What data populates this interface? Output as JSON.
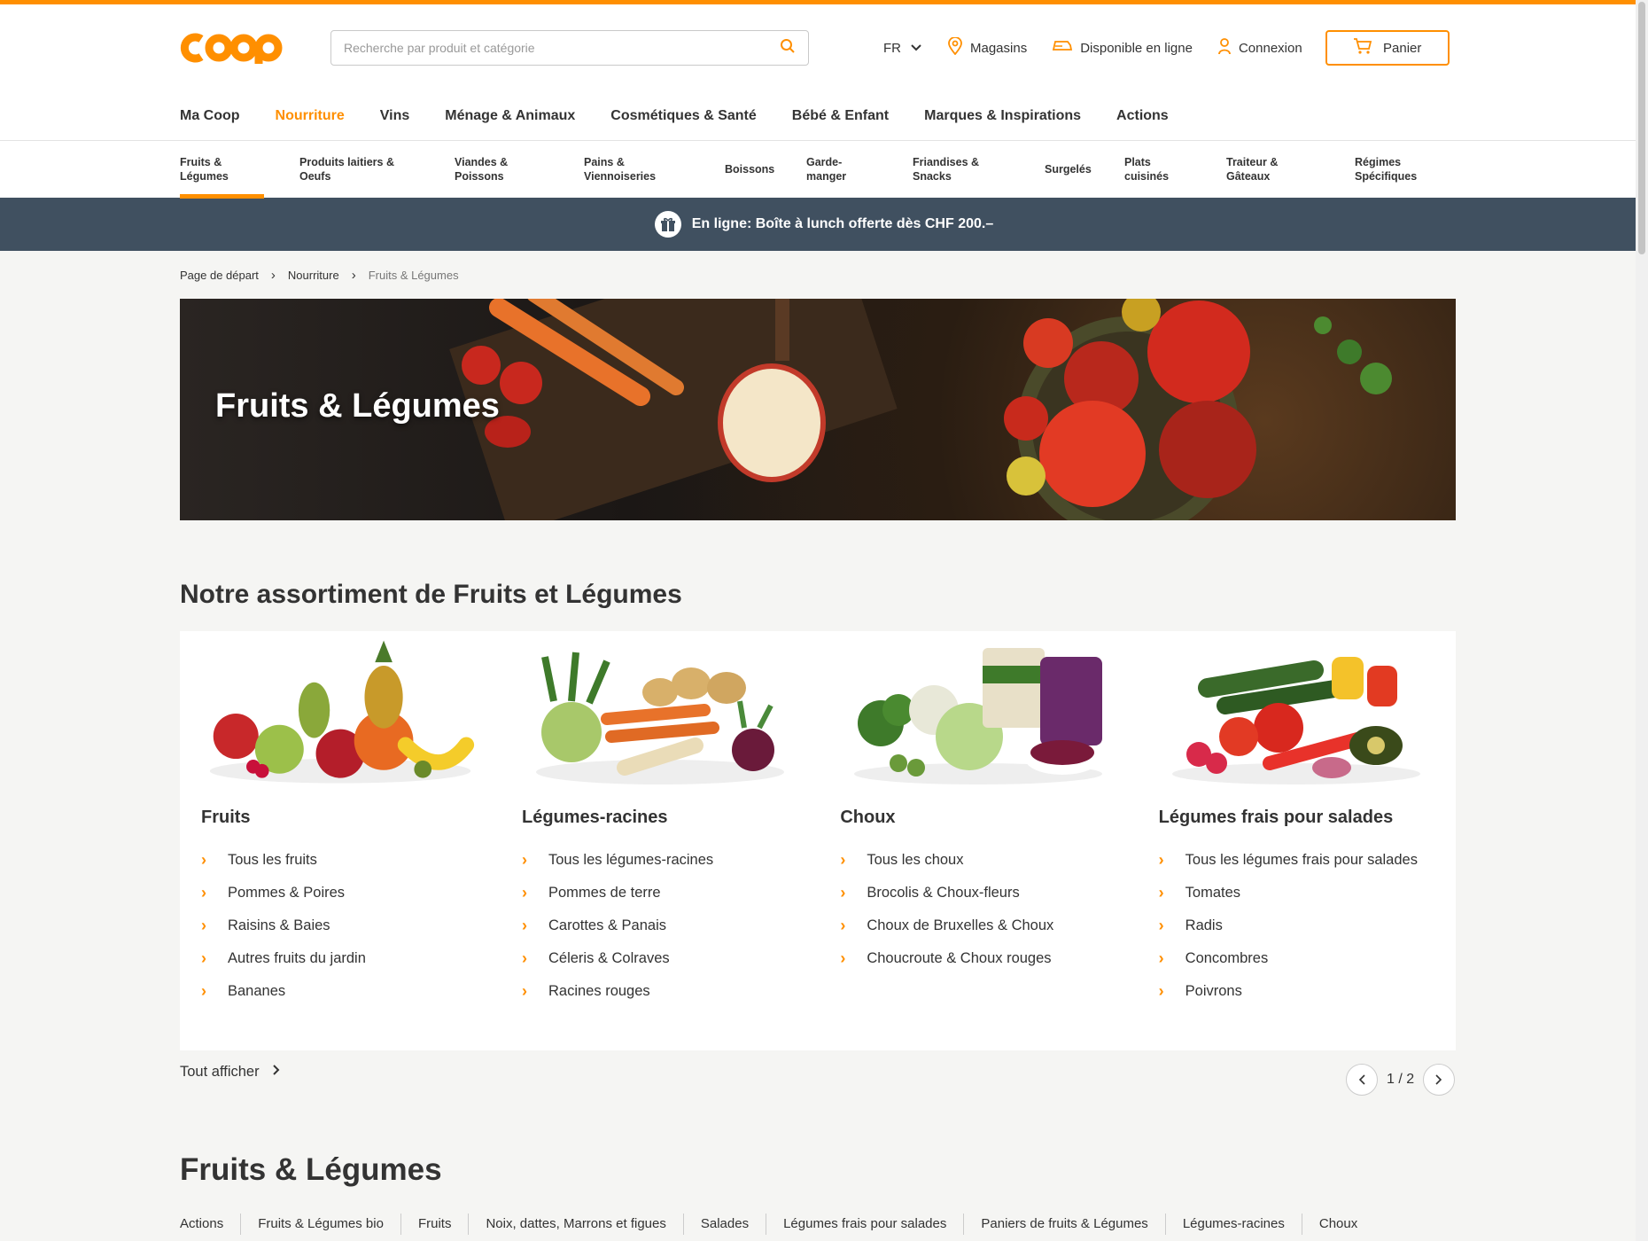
{
  "brand": {
    "logo_text": "coop",
    "accent": "#ff8f00",
    "promo_bg": "#405060"
  },
  "search": {
    "placeholder": "Recherche par produit et catégorie"
  },
  "header": {
    "lang": "FR",
    "stores": "Magasins",
    "online": "Disponible en ligne",
    "login": "Connexion",
    "cart": "Panier"
  },
  "main_nav": [
    {
      "label": "Ma Coop"
    },
    {
      "label": "Nourriture",
      "active": true
    },
    {
      "label": "Vins"
    },
    {
      "label": "Ménage & Animaux"
    },
    {
      "label": "Cosmétiques & Santé"
    },
    {
      "label": "Bébé & Enfant"
    },
    {
      "label": "Marques & Inspirations"
    },
    {
      "label": "Actions"
    }
  ],
  "sub_nav": [
    {
      "line1": "Fruits &",
      "line2": "Légumes",
      "active": true
    },
    {
      "line1": "Produits laitiers &",
      "line2": "Oeufs"
    },
    {
      "line1": "Viandes &",
      "line2": "Poissons"
    },
    {
      "line1": "Pains &",
      "line2": "Viennoiseries"
    },
    {
      "line1": "Boissons",
      "line2": ""
    },
    {
      "line1": "Garde-",
      "line2": "manger"
    },
    {
      "line1": "Friandises &",
      "line2": "Snacks"
    },
    {
      "line1": "Surgelés",
      "line2": ""
    },
    {
      "line1": "Plats",
      "line2": "cuisinés"
    },
    {
      "line1": "Traiteur &",
      "line2": "Gâteaux"
    },
    {
      "line1": "Régimes",
      "line2": "Spécifiques"
    }
  ],
  "promo": {
    "text": "En ligne: Boîte à lunch offerte dès CHF 200.–"
  },
  "breadcrumb": {
    "home": "Page de départ",
    "parent": "Nourriture",
    "current": "Fruits & Légumes"
  },
  "hero": {
    "title": "Fruits & Légumes"
  },
  "assortment": {
    "title": "Notre assortiment de Fruits et Légumes",
    "cards": [
      {
        "title": "Fruits",
        "links": [
          "Tous les fruits",
          "Pommes & Poires",
          "Raisins & Baies",
          "Autres fruits du jardin",
          "Bananes"
        ]
      },
      {
        "title": "Légumes-racines",
        "links": [
          "Tous les légumes-racines",
          "Pommes de terre",
          "Carottes & Panais",
          "Céleris & Colraves",
          "Racines rouges"
        ]
      },
      {
        "title": "Choux",
        "links": [
          "Tous les choux",
          "Brocolis & Choux-fleurs",
          "Choux de Bruxelles & Choux",
          "Choucroute & Choux rouges"
        ]
      },
      {
        "title": "Légumes frais pour salades",
        "links": [
          "Tous les légumes frais pour salades",
          "Tomates",
          "Radis",
          "Concombres",
          "Poivrons"
        ]
      }
    ],
    "show_all": "Tout afficher",
    "pager": "1 / 2"
  },
  "bottom_section": {
    "title": "Fruits & Légumes",
    "tabs": [
      "Actions",
      "Fruits & Légumes bio",
      "Fruits",
      "Noix, dattes, Marrons et figues",
      "Salades",
      "Légumes frais pour salades",
      "Paniers de fruits & Légumes",
      "Légumes-racines",
      "Choux"
    ]
  }
}
